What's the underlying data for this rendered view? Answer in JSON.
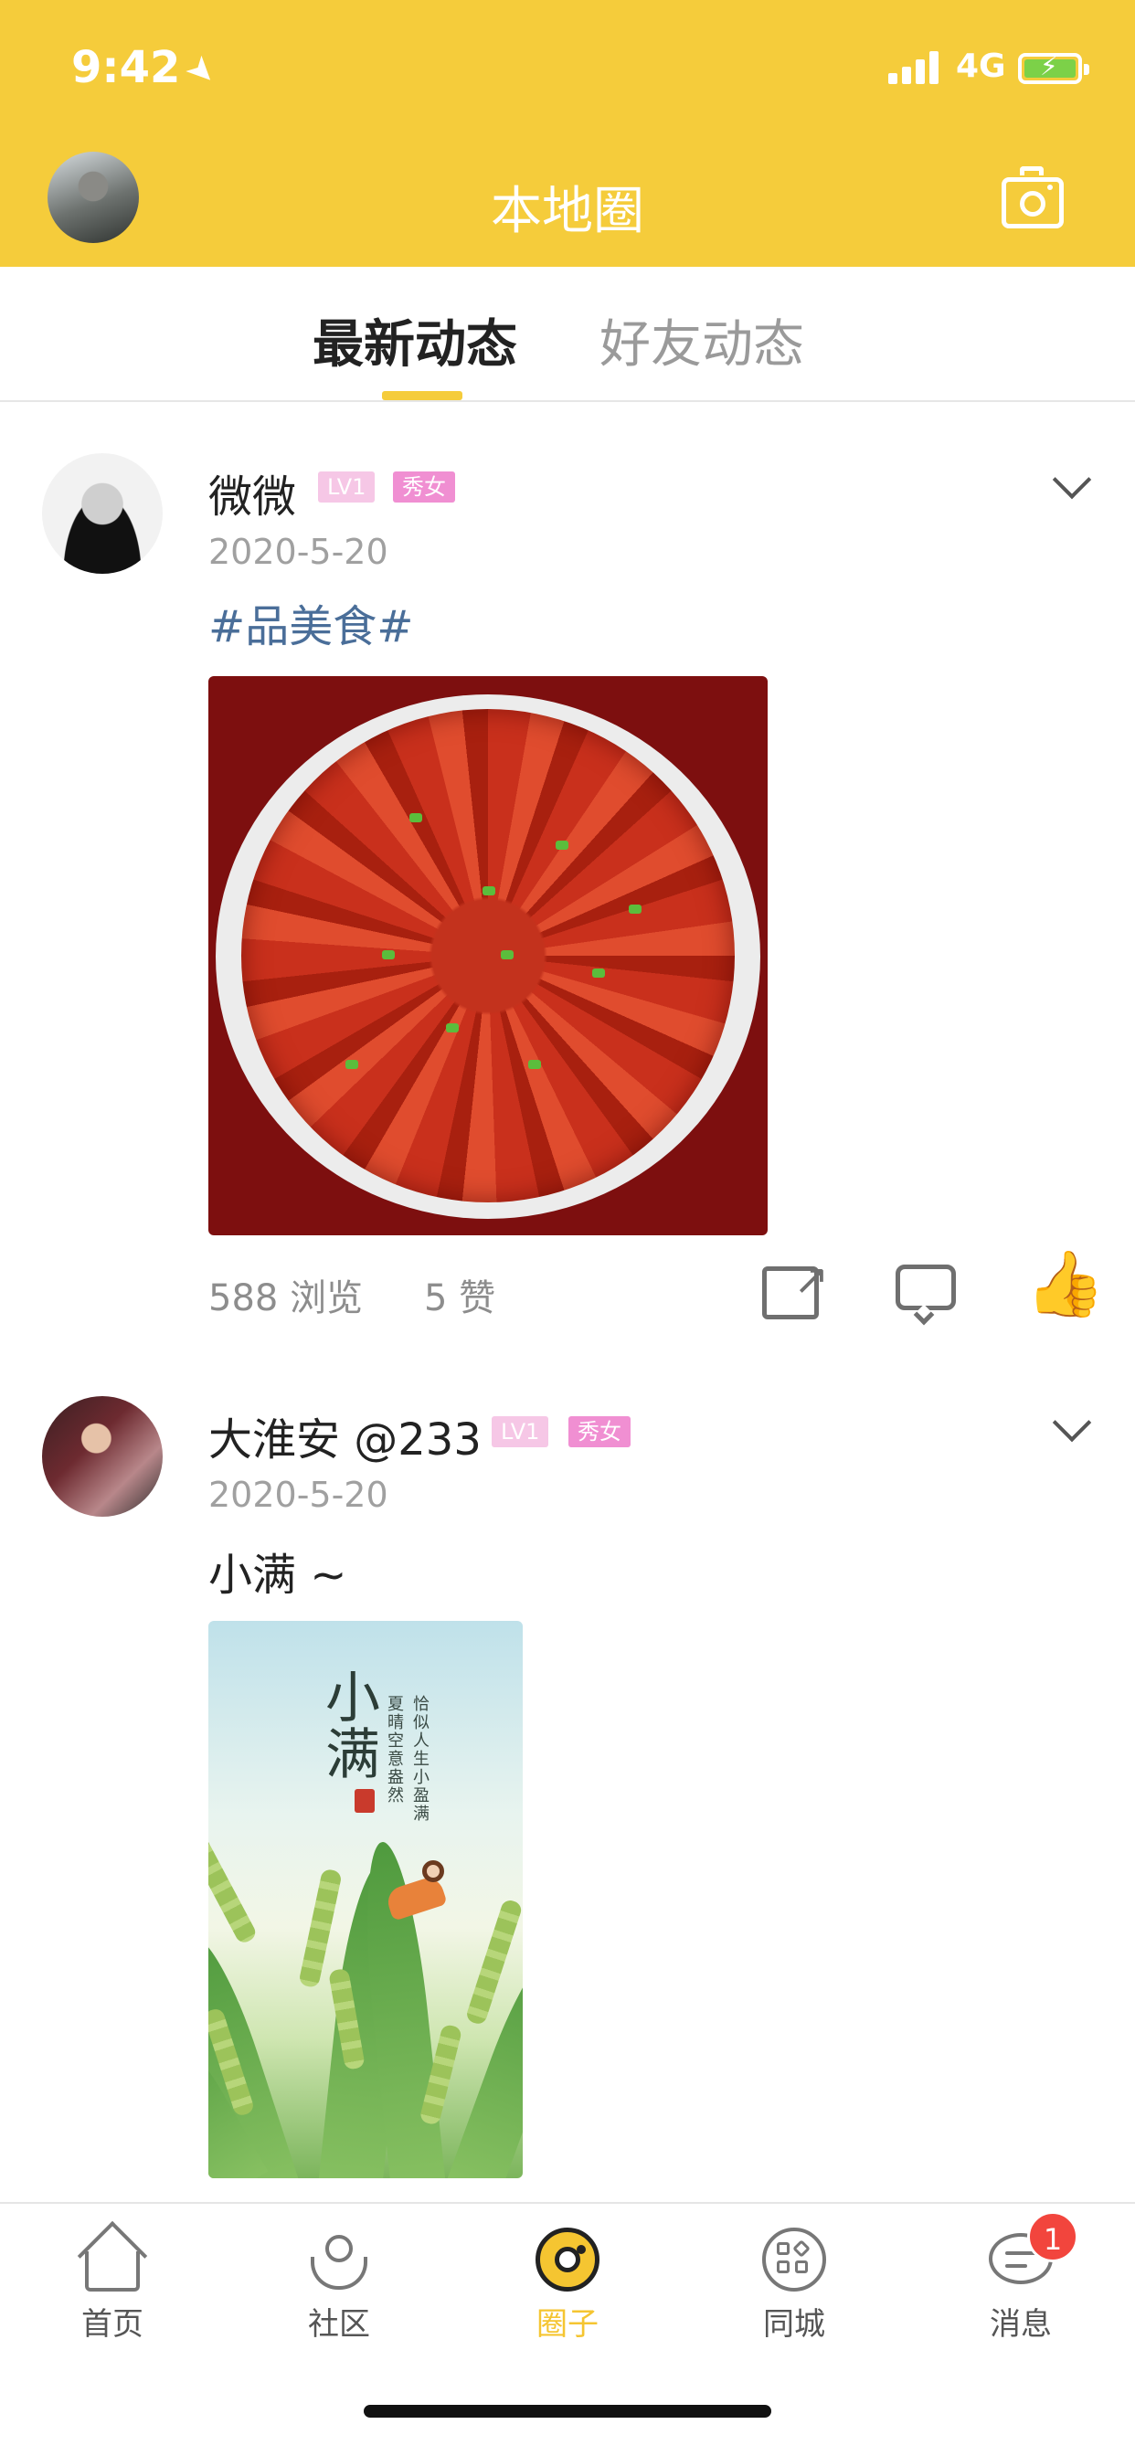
{
  "status_bar": {
    "time": "9:42",
    "network": "4G"
  },
  "nav": {
    "title": "本地圈"
  },
  "tabs": [
    {
      "label": "最新动态",
      "active": true
    },
    {
      "label": "好友动态",
      "active": false
    }
  ],
  "posts": [
    {
      "author": "微微",
      "level_badge": "LV1",
      "tag_badge": "秀女",
      "date": "2020-5-20",
      "text": "#品美食#",
      "views": "588 浏览",
      "likes": "5 赞",
      "liked": true
    },
    {
      "author": "大淮安 @233",
      "level_badge": "LV1",
      "tag_badge": "秀女",
      "date": "2020-5-20",
      "text": "小满 ~",
      "poster": {
        "title": "小满",
        "line1": "恰似人生小盈满",
        "line2": "夏晴空意盎然"
      }
    }
  ],
  "tabbar": [
    {
      "label": "首页",
      "icon": "home-icon"
    },
    {
      "label": "社区",
      "icon": "community-icon"
    },
    {
      "label": "圈子",
      "icon": "circle-icon",
      "active": true
    },
    {
      "label": "同城",
      "icon": "grid-icon"
    },
    {
      "label": "消息",
      "icon": "message-icon",
      "badge": "1"
    }
  ],
  "colors": {
    "brand_yellow": "#f5cc3b",
    "hashtag_blue": "#4a6e99",
    "badge_pink": "#f08fd2",
    "notify_red": "#f2453d"
  }
}
